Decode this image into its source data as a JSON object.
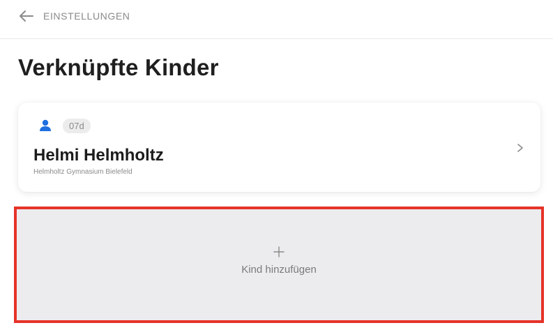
{
  "nav": {
    "back_icon": "arrow-left-icon",
    "back_label": "EINSTELLUNGEN"
  },
  "page": {
    "title": "Verknüpfte Kinder"
  },
  "children": [
    {
      "icon": "person-icon",
      "class": "07d",
      "name": "Helmi Helmholtz",
      "school": "Helmholtz Gymnasium Bielefeld"
    }
  ],
  "add_child": {
    "icon": "plus-icon",
    "label": "Kind hinzufügen"
  },
  "colors": {
    "accent": "#1e6fe0",
    "highlight_border": "#e63329",
    "muted_text": "#8a8a8a",
    "add_background": "#ececef"
  }
}
